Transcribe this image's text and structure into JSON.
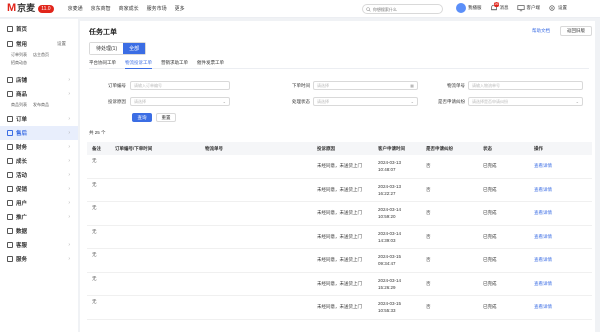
{
  "topbar": {
    "logo_text": "京麦",
    "logo_version": "11.0",
    "nav": [
      "京麦通",
      "京东商智",
      "商家成长",
      "服务市场",
      "更多"
    ],
    "search_placeholder": "你想搜索什么",
    "user_label": "我播服",
    "message_label": "消息",
    "message_badge": "26",
    "customer_label": "客户端",
    "settings_label": "设置"
  },
  "sidebar": {
    "home": "首页",
    "common": "常用",
    "common_settings": "设置",
    "common_subs": [
      "订单列表",
      "店主首页",
      "招商动态"
    ],
    "items": [
      {
        "label": "店铺",
        "icon": "store-icon"
      },
      {
        "label": "商品",
        "icon": "goods-icon"
      },
      {
        "label": "订单",
        "icon": "order-icon"
      },
      {
        "label": "售后",
        "icon": "after-sale-icon"
      },
      {
        "label": "财务",
        "icon": "finance-icon"
      },
      {
        "label": "成长",
        "icon": "growth-icon"
      },
      {
        "label": "活动",
        "icon": "activity-icon"
      },
      {
        "label": "促销",
        "icon": "promo-icon"
      },
      {
        "label": "用户",
        "icon": "user-icon"
      },
      {
        "label": "推广",
        "icon": "ads-icon"
      },
      {
        "label": "数据",
        "icon": "data-icon"
      },
      {
        "label": "客服",
        "icon": "service-icon"
      },
      {
        "label": "服务",
        "icon": "services-icon"
      }
    ],
    "goods_subs": [
      "商品列表",
      "发布商品"
    ]
  },
  "main": {
    "title": "任务工单",
    "help": "帮助文档",
    "back": "返回旧版",
    "status_tabs": [
      "待处理(1)",
      "全部"
    ],
    "type_tabs": [
      "平台协同工单",
      "物流投诉工单",
      "营销求助工单",
      "催件发票工单"
    ],
    "form": {
      "order_no_label": "订单编号",
      "order_no_placeholder": "请输入订单编号",
      "order_time_label": "下单时间",
      "order_time_placeholder": "请选择",
      "waybill_label": "物流单号",
      "waybill_placeholder": "请输入物流单号",
      "reason_label": "投诉原因",
      "reason_placeholder": "请选择",
      "status_label": "处理状态",
      "status_placeholder": "请选择",
      "dispute_label": "是否申请纠纷",
      "dispute_placeholder": "请选择是否申请纠纷",
      "search_btn": "查询",
      "reset_btn": "重置"
    },
    "total": "共 25 个"
  },
  "table": {
    "headers": [
      "备注",
      "订单编号/下单时间",
      "物流单号",
      "投诉原因",
      "客户申请时间",
      "是否申请纠纷",
      "状态",
      "操作"
    ],
    "rows": [
      {
        "note": "无",
        "reason": "未经同意，未送货上门",
        "date": "2024-03-13",
        "time": "10:48:07",
        "dispute": "否",
        "status": "已完成",
        "action": "查看详情"
      },
      {
        "note": "无",
        "reason": "未经同意，未送货上门",
        "date": "2024-03-13",
        "time": "16:22:27",
        "dispute": "否",
        "status": "已完成",
        "action": "查看详情"
      },
      {
        "note": "无",
        "reason": "未经同意，未送货上门",
        "date": "2024-03-14",
        "time": "10:59:20",
        "dispute": "否",
        "status": "已完成",
        "action": "查看详情"
      },
      {
        "note": "无",
        "reason": "未经同意，未送货上门",
        "date": "2024-03-14",
        "time": "14:39:03",
        "dispute": "否",
        "status": "已完成",
        "action": "查看详情"
      },
      {
        "note": "无",
        "reason": "未经同意，未送货上门",
        "date": "2024-03-15",
        "time": "09:34:47",
        "dispute": "否",
        "status": "已完成",
        "action": "查看详情"
      },
      {
        "note": "无",
        "reason": "未经同意，未送货上门",
        "date": "2024-03-14",
        "time": "15:26:29",
        "dispute": "否",
        "status": "已完成",
        "action": "查看详情"
      },
      {
        "note": "无",
        "reason": "未经同意，未送货上门",
        "date": "2024-03-15",
        "time": "10:55:33",
        "dispute": "否",
        "status": "已完成",
        "action": "查看详情"
      }
    ]
  },
  "colors": {
    "brand": "#e1251b",
    "accent": "#3b6de4"
  }
}
